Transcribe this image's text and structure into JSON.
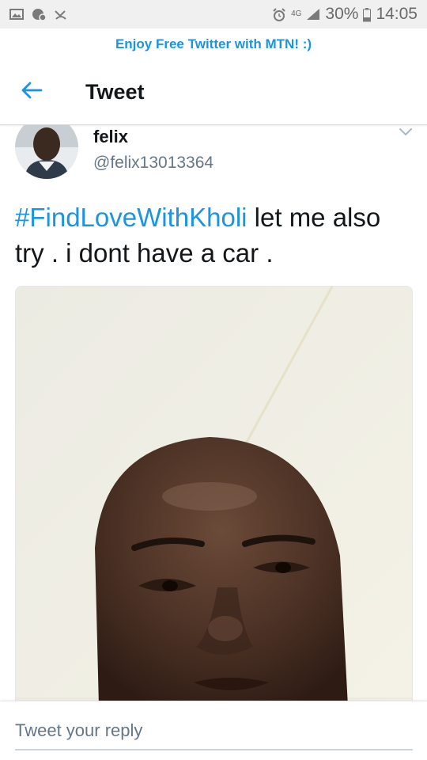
{
  "status_bar": {
    "network": "4G",
    "battery": "30%",
    "time": "14:05",
    "icons": [
      "image-icon",
      "notification-icon",
      "missed-call-icon",
      "alarm-icon",
      "network-icon",
      "signal-icon",
      "battery-icon"
    ]
  },
  "promo": {
    "text": "Enjoy Free Twitter with MTN! :)"
  },
  "app_bar": {
    "title": "Tweet",
    "back_icon": "back-arrow-icon"
  },
  "tweet": {
    "name": "felix",
    "handle": "@felix13013364",
    "hashtag": "#FindLoveWithKholi",
    "body": " let me also try . i dont have a car .",
    "menu_icon": "chevron-down-icon"
  },
  "reply": {
    "placeholder": "Tweet your reply"
  },
  "colors": {
    "accent": "#1b95e0",
    "text": "#14171a",
    "secondary": "#657786",
    "status_bar_bg": "#f0f0f0"
  }
}
